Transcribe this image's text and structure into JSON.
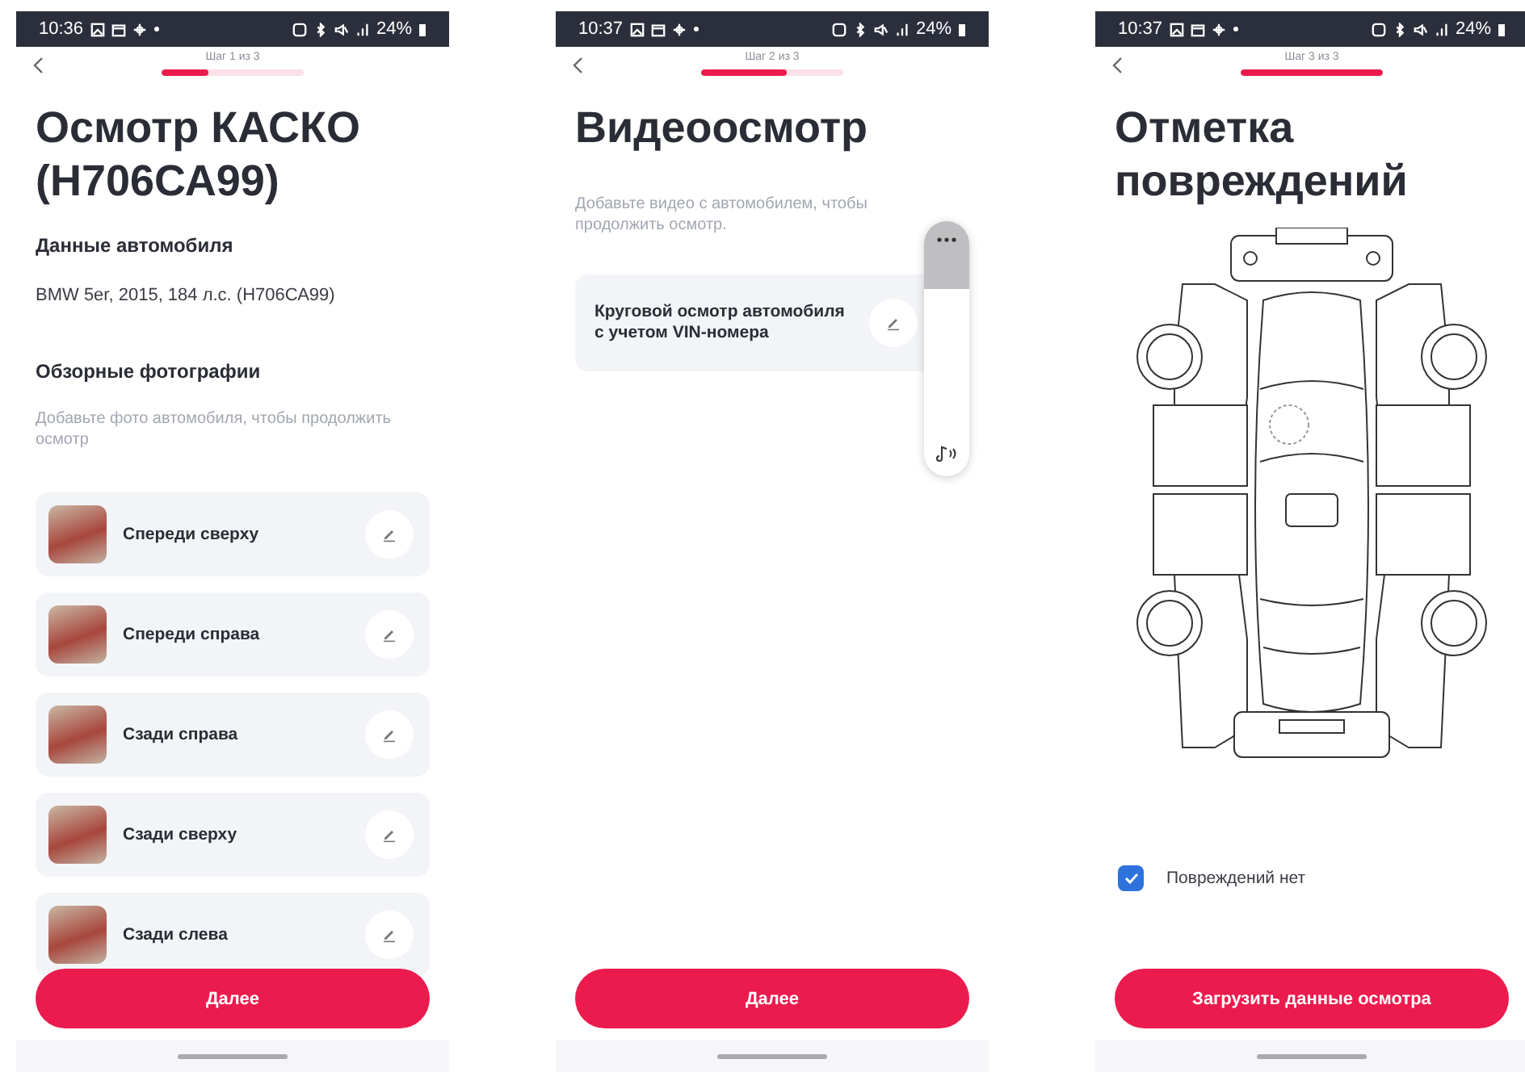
{
  "screens": [
    {
      "kind": "photos",
      "status_bar": {
        "time": "10:36",
        "battery": "24%"
      },
      "step": {
        "label": "Шаг 1 из 3",
        "level": 0.33
      },
      "title": "Осмотр КАСКО (Н706СА99)",
      "car_heading": "Данные автомобиля",
      "car_info": "BMW 5er, 2015, 184 л.с. (Н706СА99)",
      "photos_heading": "Обзорные фотографии",
      "hint": "Добавьте фото автомобиля, чтобы продолжить осмотр",
      "photos": [
        {
          "label": "Спереди сверху"
        },
        {
          "label": "Спереди справа"
        },
        {
          "label": "Сзади справа"
        },
        {
          "label": "Сзади сверху"
        },
        {
          "label": "Сзади слева"
        }
      ],
      "button": "Далее"
    },
    {
      "kind": "video",
      "status_bar": {
        "time": "10:37",
        "battery": "24%"
      },
      "step": {
        "label": "Шаг 2 из 3",
        "level": 0.6
      },
      "title": "Видеоосмотр",
      "hint": "Добавьте видео с автомобилем, чтобы продолжить осмотр.",
      "video_card": "Круговой осмотр автомобиля с учетом VIN-номера",
      "button": "Далее"
    },
    {
      "kind": "damage",
      "status_bar": {
        "time": "10:37",
        "battery": "24%"
      },
      "step": {
        "label": "Шаг 3 из 3",
        "level": 1
      },
      "title": "Отметка повреждений",
      "no_damage": {
        "label": "Повреждений нет",
        "checked": true
      },
      "button": "Загрузить данные осмотра"
    }
  ]
}
